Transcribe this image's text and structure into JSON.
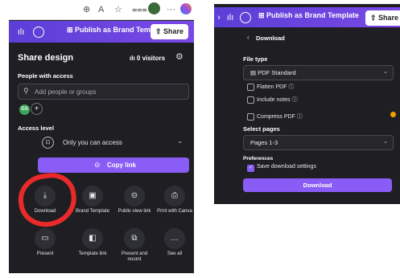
{
  "left": {
    "browser": {
      "zoom_icon": "zoom-icon",
      "reader_icon": "reader-icon",
      "favorites_icon": "star-icon",
      "collections_icon": "collections-icon",
      "more_icon": "more-icon"
    },
    "toolbar": {
      "publish_label": "Publish as Brand Template",
      "share_label": "Share",
      "analytics_icon": "chart-icon",
      "comment_icon": "comment-icon"
    },
    "share": {
      "title": "Share design",
      "visitors": "0 visitors",
      "people_label": "People with access",
      "search_placeholder": "Add people or groups",
      "avatar_initials": "GS",
      "add_person": "+",
      "access_label": "Access level",
      "access_value": "Only you can access",
      "copy_link": "Copy link"
    },
    "options": [
      {
        "label": "Download",
        "icon": "download-icon",
        "glyph": "⤓"
      },
      {
        "label": "Brand Template",
        "icon": "brand-template-icon",
        "glyph": "▣"
      },
      {
        "label": "Public view link",
        "icon": "link-icon",
        "glyph": "⊝"
      },
      {
        "label": "Print with Canva",
        "icon": "print-icon",
        "glyph": "⎙"
      },
      {
        "label": "Present",
        "icon": "present-icon",
        "glyph": "▭"
      },
      {
        "label": "Template link",
        "icon": "template-link-icon",
        "glyph": "◧"
      },
      {
        "label": "Present and record",
        "icon": "record-icon",
        "glyph": "⧉"
      },
      {
        "label": "See all",
        "icon": "more-icon",
        "glyph": "…"
      }
    ],
    "annotation": {
      "color": "#ea2a2a"
    }
  },
  "right": {
    "toolbar": {
      "publish_label": "Publish as Brand Template",
      "share_label": "Share"
    },
    "download": {
      "back_label": "Download",
      "file_type_label": "File type",
      "file_type_value": "PDF Standard",
      "flatten_pdf": "Flatten PDF",
      "include_notes": "Include notes",
      "compress_pdf": "Compress PDF",
      "select_pages_label": "Select pages",
      "pages_value": "Pages 1-3",
      "preferences_label": "Preferences",
      "save_settings": "Save download settings",
      "download_button": "Download"
    }
  },
  "colors": {
    "accent": "#8a5cf6",
    "toolbar_start": "#5b3fd6",
    "toolbar_end": "#7a48e6",
    "panel_bg": "#1f1f23",
    "premium": "#f0a000"
  }
}
